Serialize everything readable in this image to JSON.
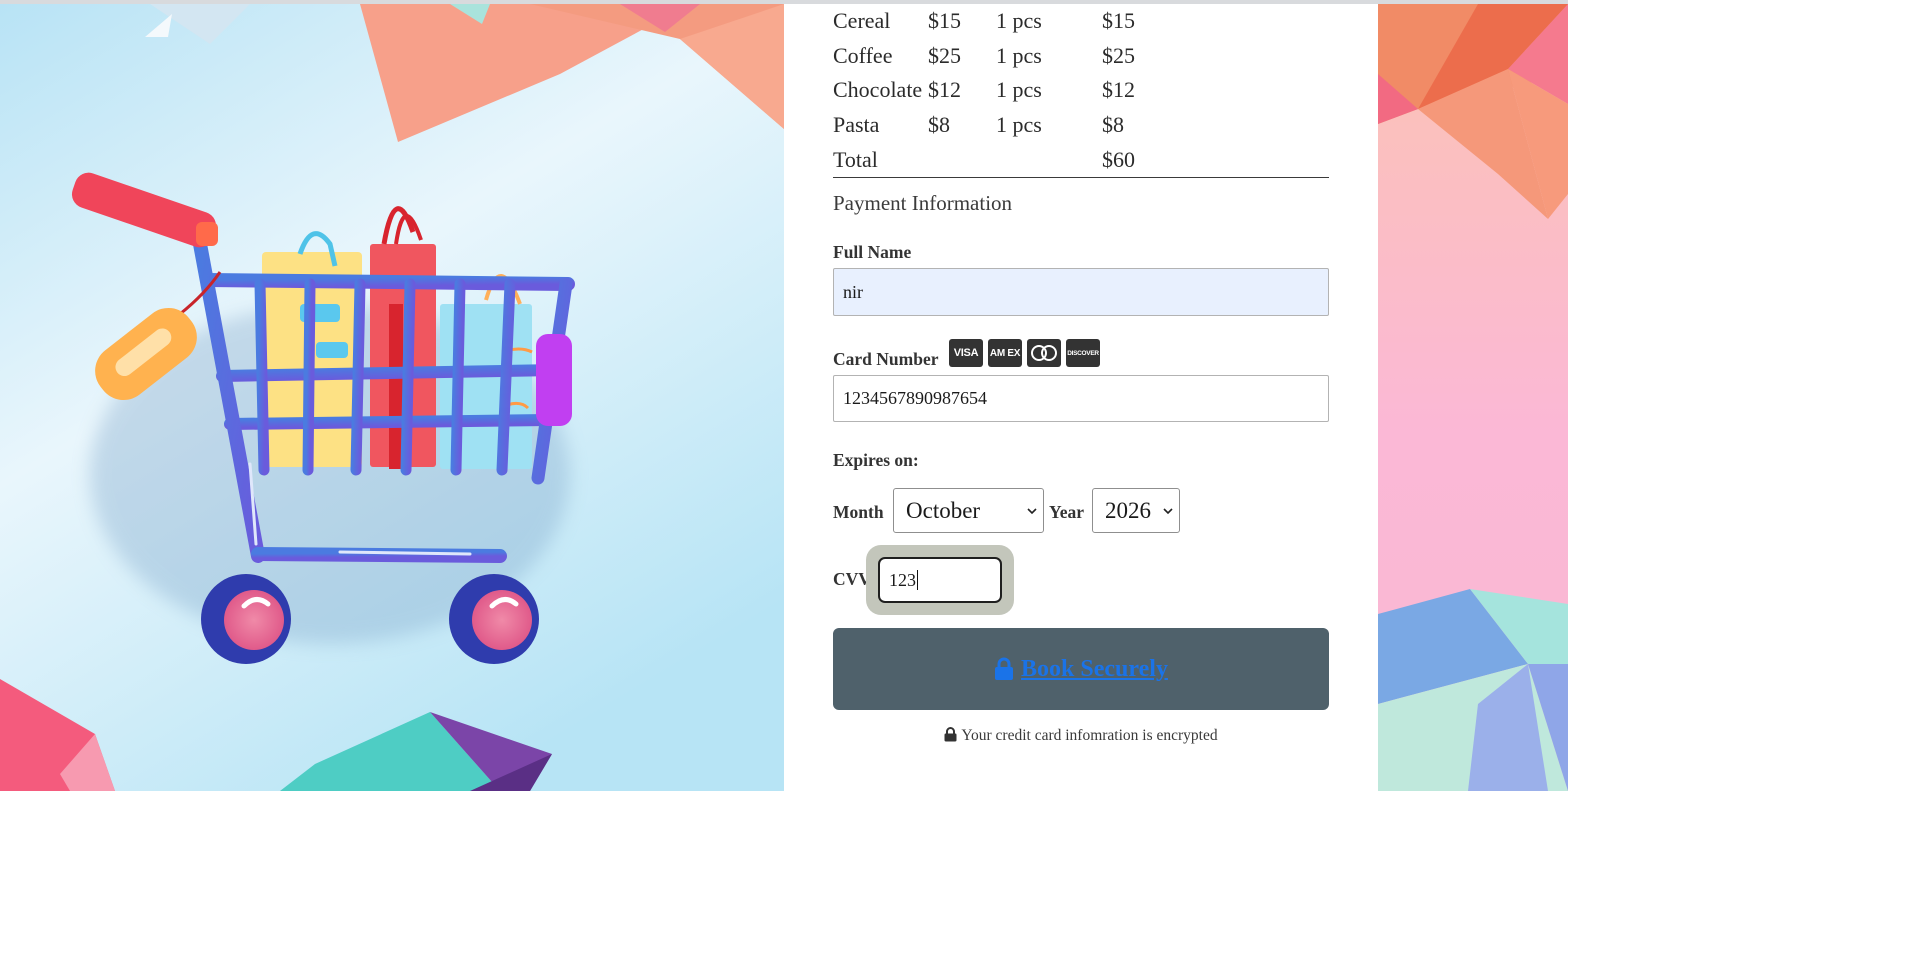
{
  "order": {
    "items": [
      {
        "name": "Cereal",
        "price": "$15",
        "qty": "1 pcs",
        "subtotal": "$15"
      },
      {
        "name": "Coffee",
        "price": "$25",
        "qty": "1 pcs",
        "subtotal": "$25"
      },
      {
        "name": "Chocolate",
        "price": "$12",
        "qty": "1 pcs",
        "subtotal": "$12"
      },
      {
        "name": "Pasta",
        "price": "$8",
        "qty": "1 pcs",
        "subtotal": "$8"
      }
    ],
    "total_label": "Total",
    "total_value": "$60"
  },
  "payment": {
    "section_title": "Payment Information",
    "full_name_label": "Full Name",
    "full_name_value": "nir",
    "card_number_label": "Card Number",
    "card_number_value": "1234567890987654",
    "card_brands": [
      {
        "label": "VISA",
        "icon": "visa-icon"
      },
      {
        "label": "AM EX",
        "icon": "amex-icon"
      },
      {
        "label": "mastercard",
        "icon": "mastercard-icon"
      },
      {
        "label": "DISCOVER",
        "icon": "discover-icon"
      }
    ],
    "expires_label": "Expires on:",
    "month_label": "Month",
    "month_value": "October",
    "year_label": "Year",
    "year_value": "2026",
    "cvv_label": "CVV",
    "cvv_value": "123"
  },
  "actions": {
    "book_label": "Book Securely",
    "book_icon": "lock-icon"
  },
  "footer": {
    "encrypt_note": "Your credit card infomration is encrypted",
    "encrypt_icon": "lock-icon"
  },
  "colors": {
    "button_bg": "#4f616b",
    "link": "#1a73e8",
    "autofill_bg": "#e8f0fe",
    "cvv_focus_ring": "#c3c6bb",
    "illustration_bg": "#bfe6f5"
  }
}
